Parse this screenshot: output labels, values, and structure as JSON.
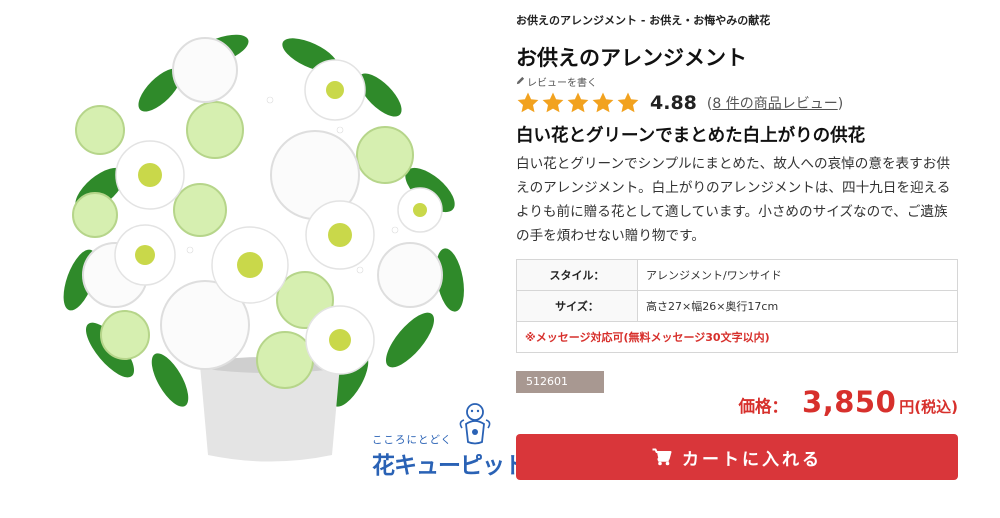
{
  "breadcrumb": "お供えのアレンジメント - お供え・お悔やみの献花",
  "product": {
    "title": "お供えのアレンジメント",
    "review_link_label": "レビューを書く",
    "rating": "4.88",
    "review_count_prefix": "(",
    "review_count_link": "8 件の商品レビュー",
    "review_count_suffix": ")",
    "star_count": 5,
    "rating_stars_filled": 5,
    "subtitle": "白い花とグリーンでまとめた白上がりの供花",
    "description": "白い花とグリーンでシンプルにまとめた、故人への哀悼の意を表すお供えのアレンジメント。白上がりのアレンジメントは、四十九日を迎えるよりも前に贈る花として適しています。小さめのサイズなので、ご遺族の手を煩わせない贈り物です。",
    "specs": [
      {
        "label": "スタイル：",
        "value": "アレンジメント/ワンサイド"
      },
      {
        "label": "サイズ：",
        "value": "高さ27×幅26×奥行17cm"
      }
    ],
    "message_note": "※メッセージ対応可(無料メッセージ30文字以内)",
    "code": "512601",
    "price_label": "価格：",
    "price": "3,850",
    "price_unit": "円(税込)",
    "cart_button_label": "カートに入れる"
  },
  "brand": {
    "tagline": "こころにとどく",
    "name": "花キューピット"
  },
  "colors": {
    "accent_red": "#d9363a",
    "price_red": "#d7302c",
    "star_orange": "#f2a21f",
    "brand_blue": "#2a62b5",
    "code_badge": "#a89891"
  },
  "icons": [
    "pencil-icon",
    "star-icon",
    "cart-icon",
    "mascot-icon"
  ]
}
